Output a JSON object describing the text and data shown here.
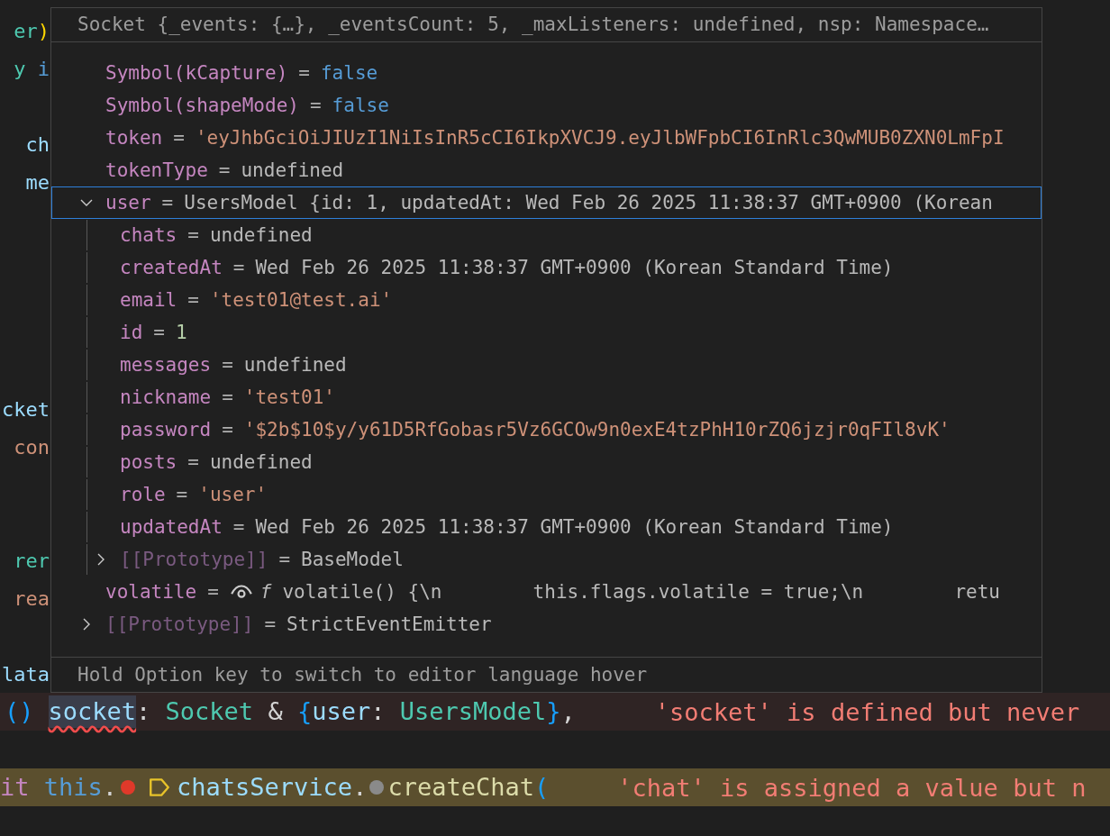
{
  "editor": {
    "lines": [
      {
        "kind": "fragment",
        "tokens": [
          {
            "text": "er",
            "kind": "type"
          },
          {
            "text": ")",
            "kind": "bracket"
          }
        ]
      },
      {
        "kind": "fragment",
        "tokens": [
          {
            "text": "y",
            "kind": "type"
          },
          {
            "text": " i",
            "kind": "keyword"
          }
        ]
      },
      {
        "kind": "blank"
      },
      {
        "kind": "fragment",
        "tokens": [
          {
            "text": "ch",
            "kind": "variable"
          }
        ]
      },
      {
        "kind": "fragment",
        "tokens": [
          {
            "text": "me",
            "kind": "variable"
          }
        ]
      },
      {
        "kind": "blank"
      },
      {
        "kind": "blank"
      },
      {
        "kind": "blank"
      },
      {
        "kind": "blank"
      },
      {
        "kind": "blank"
      },
      {
        "kind": "fragment",
        "tokens": [
          {
            "text": "cket",
            "kind": "variable"
          }
        ]
      },
      {
        "kind": "fragment",
        "tokens": [
          {
            "text": "con",
            "kind": "string"
          }
        ]
      },
      {
        "kind": "blank"
      },
      {
        "kind": "blank"
      },
      {
        "kind": "fragment",
        "tokens": [
          {
            "text": "rer",
            "kind": "type"
          }
        ]
      },
      {
        "kind": "fragment",
        "tokens": [
          {
            "text": "rea",
            "kind": "string"
          }
        ]
      },
      {
        "kind": "blank"
      },
      {
        "kind": "fragment",
        "tokens": [
          {
            "text": "lata",
            "kind": "variable"
          }
        ]
      },
      {
        "kind": "error",
        "tokens": [
          {
            "text": "()",
            "kind": "bracket-blue"
          },
          {
            "text": "socket",
            "kind": "variable-dim",
            "squiggle": true
          },
          {
            "text": ": ",
            "kind": "punct"
          },
          {
            "text": "Socket",
            "kind": "type"
          },
          {
            "text": " & ",
            "kind": "punct"
          },
          {
            "text": "{",
            "kind": "bracket-blue"
          },
          {
            "text": "user",
            "kind": "variable"
          },
          {
            "text": ": ",
            "kind": "punct"
          },
          {
            "text": "UsersModel",
            "kind": "type"
          },
          {
            "text": "}",
            "kind": "bracket-blue"
          },
          {
            "text": ",",
            "kind": "punct"
          },
          {
            "text": "'socket' is defined but never",
            "kind": "message"
          }
        ]
      },
      {
        "kind": "blank"
      },
      {
        "kind": "warning",
        "tokens": [
          {
            "text": "it",
            "kind": "control"
          },
          {
            "text": " this",
            "kind": "keyword"
          },
          {
            "text": ".",
            "kind": "punct"
          },
          {
            "kind": "breakpoint"
          },
          {
            "kind": "tag"
          },
          {
            "text": "chatsService",
            "kind": "variable"
          },
          {
            "text": ".",
            "kind": "punct"
          },
          {
            "kind": "hint"
          },
          {
            "text": "createChat",
            "kind": "function"
          },
          {
            "text": "(",
            "kind": "bracket-blue"
          },
          {
            "text": "'chat' is assigned a value but n",
            "kind": "message"
          }
        ]
      }
    ]
  },
  "hover": {
    "header": "Socket {_events: {…}, _eventsCount: 5, _maxListeners: undefined, nsp: Namespace…",
    "rows": [
      {
        "name": "Symbol(kCapture)",
        "sep": "=",
        "value": "false",
        "kind": "boolean",
        "selected": false
      },
      {
        "name": "Symbol(shapeMode)",
        "sep": "=",
        "value": "false",
        "kind": "boolean",
        "selected": false
      },
      {
        "name": "token",
        "sep": "=",
        "value": "'eyJhbGciOiJIUzI1NiIsInR5cCI6IkpXVCJ9.eyJlbWFpbCI6InRlc3QwMUB0ZXN0LmFpI",
        "kind": "string",
        "selected": false
      },
      {
        "name": "tokenType",
        "sep": "=",
        "value": "undefined",
        "kind": "plain",
        "selected": false
      },
      {
        "name": "user",
        "sep": "=",
        "value": "UsersModel {id: 1, updatedAt: Wed Feb 26 2025 11:38:37 GMT+0900 (Korean",
        "kind": "plain",
        "expanded": true,
        "selected": true,
        "children": [
          {
            "name": "chats",
            "sep": "=",
            "value": "undefined",
            "kind": "plain",
            "selected": false
          },
          {
            "name": "createdAt",
            "sep": "=",
            "value": "Wed Feb 26 2025 11:38:37 GMT+0900 (Korean Standard Time)",
            "kind": "plain",
            "selected": false
          },
          {
            "name": "email",
            "sep": "=",
            "value": "'test01@test.ai'",
            "kind": "string",
            "selected": false
          },
          {
            "name": "id",
            "sep": "=",
            "value": "1",
            "kind": "number",
            "selected": false
          },
          {
            "name": "messages",
            "sep": "=",
            "value": "undefined",
            "kind": "plain",
            "selected": false
          },
          {
            "name": "nickname",
            "sep": "=",
            "value": "'test01'",
            "kind": "string",
            "selected": false
          },
          {
            "name": "password",
            "sep": "=",
            "value": "'$2b$10$y/y61D5RfGobasr5Vz6GCOw9n0exE4tzPhH10rZQ6jzjr0qFIl8vK'",
            "kind": "string",
            "selected": false
          },
          {
            "name": "posts",
            "sep": "=",
            "value": "undefined",
            "kind": "plain",
            "selected": false
          },
          {
            "name": "role",
            "sep": "=",
            "value": "'user'",
            "kind": "string",
            "selected": false
          },
          {
            "name": "updatedAt",
            "sep": "=",
            "value": "Wed Feb 26 2025 11:38:37 GMT+0900 (Korean Standard Time)",
            "kind": "plain",
            "selected": false
          },
          {
            "name": "[[Prototype]]",
            "sep": "=",
            "value": "BaseModel",
            "kind": "internal",
            "expanded": false,
            "selected": false
          }
        ]
      },
      {
        "name": "volatile",
        "sep": "=",
        "prefix": "f",
        "value": "volatile() {\\n        this.flags.volatile = true;\\n        retu",
        "kind": "getter",
        "selected": false
      },
      {
        "name": "[[Prototype]]",
        "sep": "=",
        "value": "StrictEventEmitter",
        "kind": "internal",
        "expanded": false,
        "selected": false
      }
    ],
    "footer": "Hold Option key to switch to editor language hover"
  }
}
